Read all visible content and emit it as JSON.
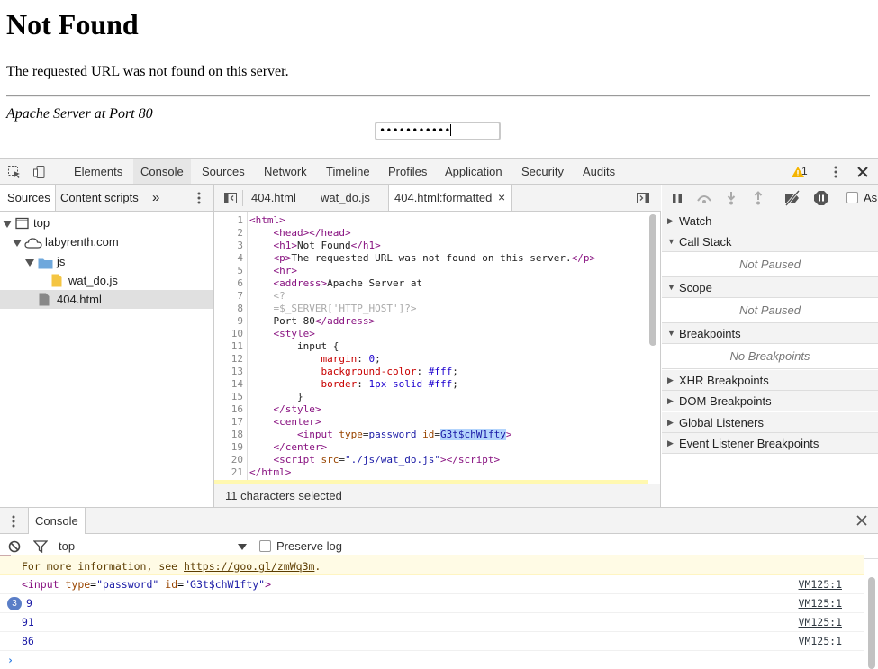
{
  "page": {
    "heading": "Not Found",
    "message": "The requested URL was not found on this server.",
    "address": "Apache Server at Port 80",
    "password_value": "•••••••••••"
  },
  "devtools": {
    "tabs": [
      "Elements",
      "Console",
      "Sources",
      "Network",
      "Timeline",
      "Profiles",
      "Application",
      "Security",
      "Audits"
    ],
    "active_tab": "Sources",
    "warning_count": "1",
    "sources": {
      "nav_tabs": [
        "Sources",
        "Content scripts",
        "»"
      ],
      "tree": {
        "top": "top",
        "domain": "labyrenth.com",
        "folder": "js",
        "file_js": "wat_do.js",
        "file_html": "404.html"
      },
      "editor_tabs": [
        "404.html",
        "wat_do.js",
        "404.html:formatted"
      ],
      "editor_tab_close": "×",
      "status": "11 characters selected",
      "line_numbers": [
        "1",
        "2",
        "3",
        "4",
        "5",
        "6",
        "7",
        "8",
        "9",
        "10",
        "11",
        "12",
        "13",
        "14",
        "15",
        "16",
        "17",
        "18",
        "19",
        "20",
        "21"
      ]
    },
    "debugger": {
      "sections": {
        "watch": "Watch",
        "call_stack": "Call Stack",
        "call_stack_empty": "Not Paused",
        "scope": "Scope",
        "scope_empty": "Not Paused",
        "breakpoints": "Breakpoints",
        "breakpoints_empty": "No Breakpoints",
        "xhr": "XHR Breakpoints",
        "dom": "DOM Breakpoints",
        "global": "Global Listeners",
        "event": "Event Listener Breakpoints"
      },
      "async_label": "As"
    },
    "drawer": {
      "tab": "Console",
      "context": "top",
      "preserve_log": "Preserve log",
      "rows": {
        "warn_text": "For more information, see ",
        "warn_link": "https://goo.gl/zmWq3m",
        "warn_tail": ".",
        "element_prefix": "<input ",
        "attr_type": "type",
        "attr_type_val": "\"password\"",
        "attr_id": "id",
        "attr_id_val": "\"G3t$chW1fty\"",
        "element_suffix": ">",
        "repeat_count": "3",
        "val1": "9",
        "val2": "91",
        "val3": "86",
        "source": "VM125:1",
        "prompt": "›"
      }
    }
  },
  "colors": {
    "warning": "#f4b400",
    "selection": "#b3d4fc",
    "tag": "#881280",
    "attr": "#994500",
    "number": "#1a1aa6"
  }
}
